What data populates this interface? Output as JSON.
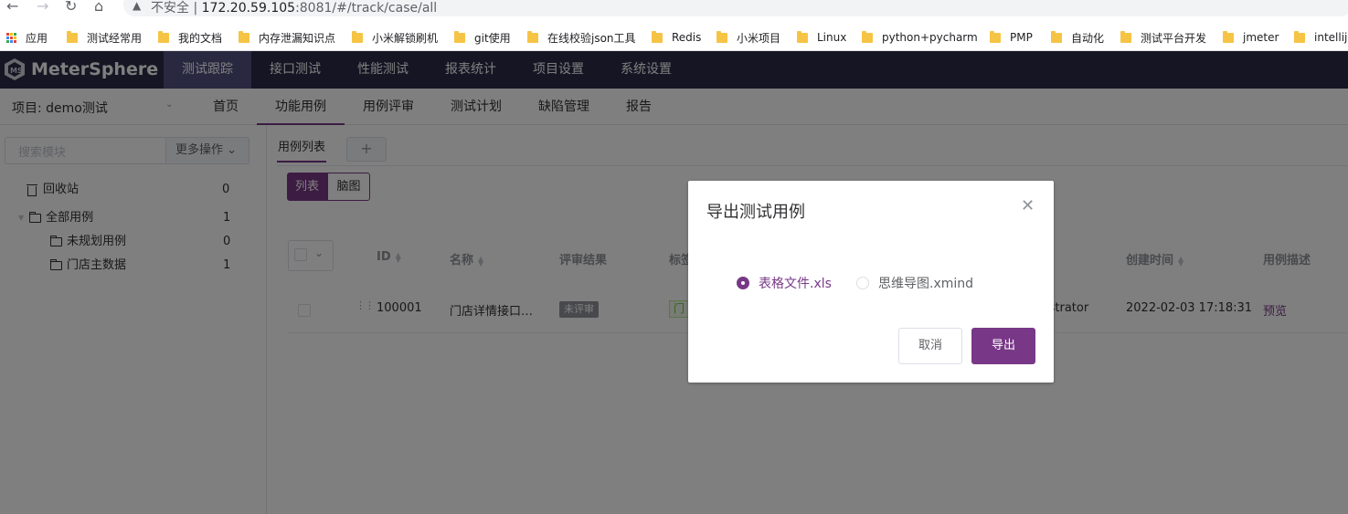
{
  "browser": {
    "back_icon": "arrow-left-icon",
    "security_label": "不安全",
    "url_host": "172.20.59.105",
    "url_rest": ":8081/#/track/case/all",
    "bookmarks": [
      "应用",
      "测试经常用",
      "我的文档",
      "内存泄漏知识点",
      "小米解锁刷机",
      "git使用",
      "在线校验json工具",
      "Redis",
      "小米项目",
      "Linux",
      "python+pycharm",
      "PMP",
      "自动化",
      "测试平台开发",
      "jmeter",
      "intellij"
    ]
  },
  "header": {
    "logo": "MeterSphere",
    "menus": [
      "测试跟踪",
      "接口测试",
      "性能测试",
      "报表统计",
      "项目设置",
      "系统设置"
    ],
    "active_menu": "测试跟踪"
  },
  "subnav": {
    "project_label": "项目: demo测试",
    "items": [
      "首页",
      "功能用例",
      "用例评审",
      "测试计划",
      "缺陷管理",
      "报告"
    ],
    "active_item": "功能用例"
  },
  "sidebar": {
    "search_placeholder": "搜索模块",
    "more_label": "更多操作",
    "tree": [
      {
        "label": "回收站",
        "count": "0"
      },
      {
        "label": "全部用例",
        "count": "1"
      },
      {
        "label": "未规划用例",
        "count": "0"
      },
      {
        "label": "门店主数据",
        "count": "1"
      }
    ]
  },
  "main": {
    "tab_label": "用例列表",
    "tab_add": "+",
    "view_list": "列表",
    "view_mind": "脑图",
    "columns": [
      "ID",
      "名称",
      "评审结果",
      "标签",
      "创建时间",
      "用例描述"
    ],
    "rows": [
      {
        "id": "100001",
        "name": "门店详情接口…",
        "review": "未评审",
        "tag": "门店",
        "creator": "istrator",
        "created": "2022-02-03 17:18:31",
        "desc": "预览"
      }
    ]
  },
  "dialog": {
    "title": "导出测试用例",
    "options": [
      "表格文件.xls",
      "思维导图.xmind"
    ],
    "selected": "表格文件.xls",
    "cancel": "取消",
    "export": "导出"
  },
  "colors": {
    "accent": "#783887",
    "header_bg": "#2c2a48",
    "active_menu_bg": "#505080"
  }
}
